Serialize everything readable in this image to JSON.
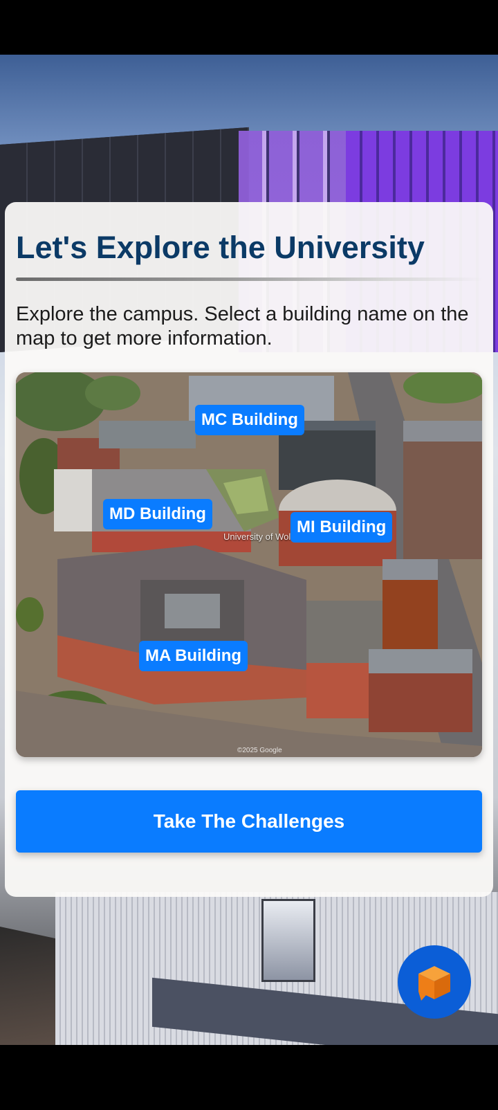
{
  "page": {
    "title": "Let's Explore the University",
    "intro": "Explore the campus. Select a building name on the map to get more information."
  },
  "map": {
    "watermark": "University of Wol",
    "credit": "©2025 Google",
    "buildings": [
      {
        "label": "MC Building"
      },
      {
        "label": "MD Building"
      },
      {
        "label": "MI Building"
      },
      {
        "label": "MA Building"
      }
    ]
  },
  "actions": {
    "challenge_button": "Take The Challenges"
  },
  "fab": {
    "icon": "cube-icon"
  },
  "colors": {
    "title": "#0b3a66",
    "accent": "#0a7cff",
    "fab_background": "#0b5ed7",
    "cube": "#f28a1c"
  }
}
